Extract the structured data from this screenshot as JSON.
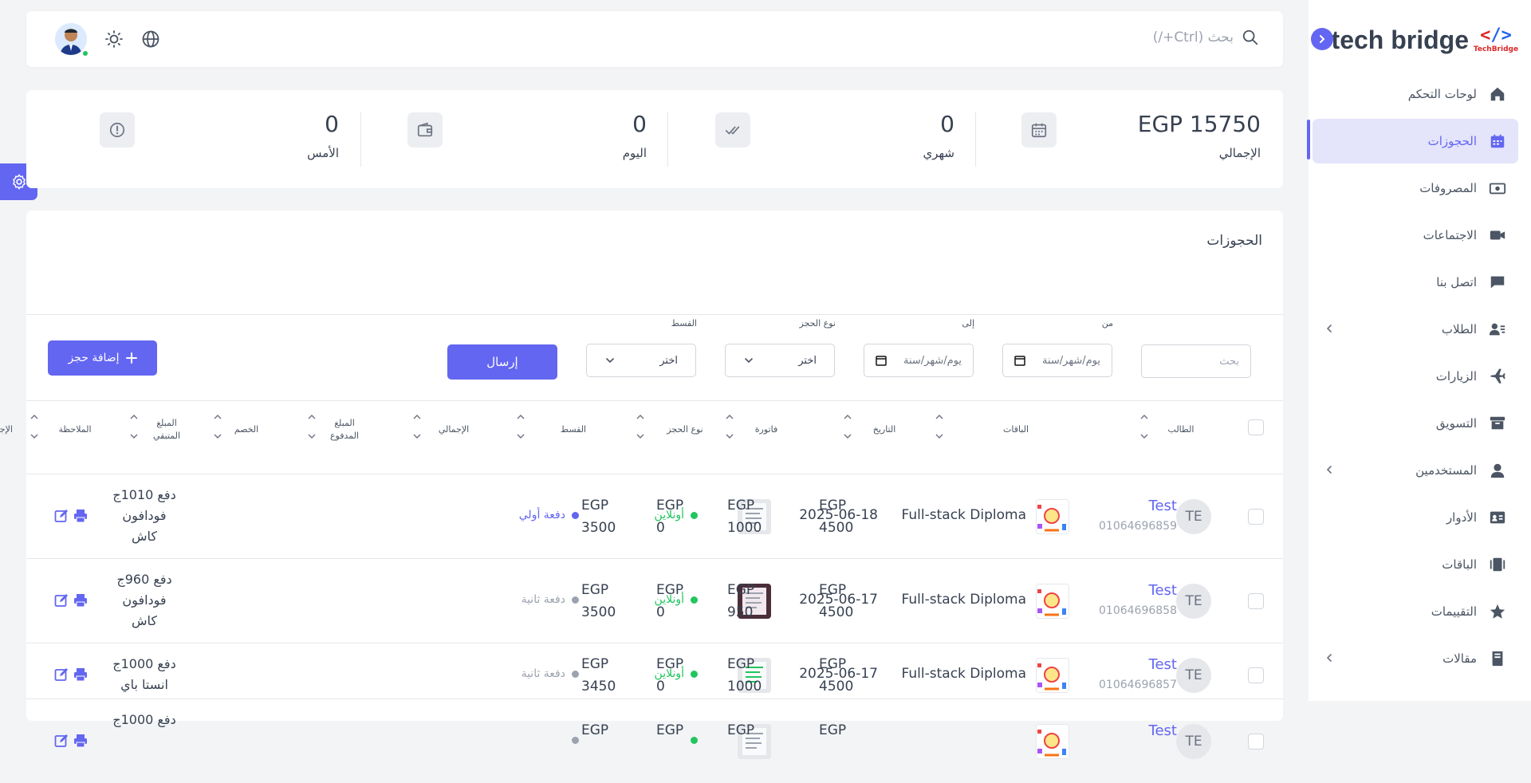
{
  "brand": {
    "name": "tech bridge",
    "mark_text": "TechBridge",
    "mark_symbol": "</>",
    "accent": "#6366f1"
  },
  "search": {
    "placeholder": "بحث (Ctrl+/)"
  },
  "sidebar": {
    "items": [
      {
        "label": "لوحات التحكم",
        "icon": "home-icon",
        "active": false,
        "expand": false
      },
      {
        "label": "الحجوزات",
        "icon": "calendar-icon",
        "active": true,
        "expand": false
      },
      {
        "label": "المصروفات",
        "icon": "cash-icon",
        "active": false,
        "expand": false
      },
      {
        "label": "الاجتماعات",
        "icon": "video-icon",
        "active": false,
        "expand": false
      },
      {
        "label": "اتصل بنا",
        "icon": "chat-icon",
        "active": false,
        "expand": false
      },
      {
        "label": "الطلاب",
        "icon": "students-icon",
        "active": false,
        "expand": true
      },
      {
        "label": "الزيارات",
        "icon": "plane-icon",
        "active": false,
        "expand": false
      },
      {
        "label": "التسويق",
        "icon": "archive-icon",
        "active": false,
        "expand": false
      },
      {
        "label": "المستخدمين",
        "icon": "user-icon",
        "active": false,
        "expand": true
      },
      {
        "label": "الأدوار",
        "icon": "id-card-icon",
        "active": false,
        "expand": false
      },
      {
        "label": "الباقات",
        "icon": "packages-icon",
        "active": false,
        "expand": false
      },
      {
        "label": "التقييمات",
        "icon": "star-icon",
        "active": false,
        "expand": false
      },
      {
        "label": "مقالات",
        "icon": "book-icon",
        "active": false,
        "expand": true
      }
    ]
  },
  "stats": [
    {
      "value": "EGP 15750",
      "label": "الإجمالي",
      "icon": "calendar-icon"
    },
    {
      "value": "0",
      "label": "شهري",
      "icon": "check-double-icon"
    },
    {
      "value": "0",
      "label": "اليوم",
      "icon": "wallet-icon"
    },
    {
      "value": "0",
      "label": "الأمس",
      "icon": "alert-circle-icon"
    }
  ],
  "bookings": {
    "title": "الحجوزات",
    "filters": {
      "search_placeholder": "بحث",
      "from_label": "من",
      "to_label": "إلى",
      "date_placeholder": "يوم/شهر/سنة",
      "type_label": "نوع الحجز",
      "type_value": "اختر",
      "installment_label": "القسط",
      "installment_value": "اختر",
      "submit": "إرسال",
      "add": "إضافة حجز"
    },
    "columns": {
      "student": "الطالب",
      "packages": "الباقات",
      "date": "التاريخ",
      "invoice": "فاتورة",
      "type": "نوع الحجز",
      "installment": "القسط",
      "total": "الإجمالي",
      "paid_1": "المبلغ",
      "paid_2": "المدفوع",
      "discount": "الخصم",
      "remaining_1": "المبلغ",
      "remaining_2": "المتبقي",
      "note": "الملاحظة",
      "actions": "الإجراءات"
    },
    "rows": [
      {
        "initials": "TE",
        "name": "Test",
        "phone": "01064696859",
        "package": "Full-stack Diploma",
        "date": "2025-06-18",
        "type": "أونلاين",
        "type_color": "#22c55e",
        "installment": "دفعة أولي",
        "installment_color": "#6366f1",
        "total_cur": "EGP",
        "total": "4500",
        "paid_cur": "EGP",
        "paid": "1000",
        "discount_cur": "EGP",
        "discount": "0",
        "remaining_cur": "EGP",
        "remaining": "3500",
        "note_1": "دفع 1010ج",
        "note_2": "فودافون",
        "note_3": "كاش"
      },
      {
        "initials": "TE",
        "name": "Test",
        "phone": "01064696858",
        "package": "Full-stack Diploma",
        "date": "2025-06-17",
        "type": "أونلاين",
        "type_color": "#22c55e",
        "installment": "دفعة ثانية",
        "installment_color": "#9ca3af",
        "total_cur": "EGP",
        "total": "4500",
        "paid_cur": "EGP",
        "paid": "950",
        "discount_cur": "EGP",
        "discount": "0",
        "remaining_cur": "EGP",
        "remaining": "3500",
        "note_1": "دفع 960ج",
        "note_2": "فودافون",
        "note_3": "كاش"
      },
      {
        "initials": "TE",
        "name": "Test",
        "phone": "01064696857",
        "package": "Full-stack Diploma",
        "date": "2025-06-17",
        "type": "أونلاين",
        "type_color": "#22c55e",
        "installment": "دفعة ثانية",
        "installment_color": "#9ca3af",
        "total_cur": "EGP",
        "total": "4500",
        "paid_cur": "EGP",
        "paid": "1000",
        "discount_cur": "EGP",
        "discount": "0",
        "remaining_cur": "EGP",
        "remaining": "3450",
        "note_1": "دفع 1000ج",
        "note_2": "انستا باي",
        "note_3": ""
      },
      {
        "initials": "TE",
        "name": "Test",
        "phone": "",
        "package": "",
        "date": "",
        "type": "",
        "type_color": "#22c55e",
        "installment": "",
        "installment_color": "#9ca3af",
        "total_cur": "EGP",
        "total": "",
        "paid_cur": "EGP",
        "paid": "",
        "discount_cur": "EGP",
        "discount": "",
        "remaining_cur": "EGP",
        "remaining": "",
        "note_1": "دفع 1000ج",
        "note_2": "",
        "note_3": ""
      }
    ]
  }
}
